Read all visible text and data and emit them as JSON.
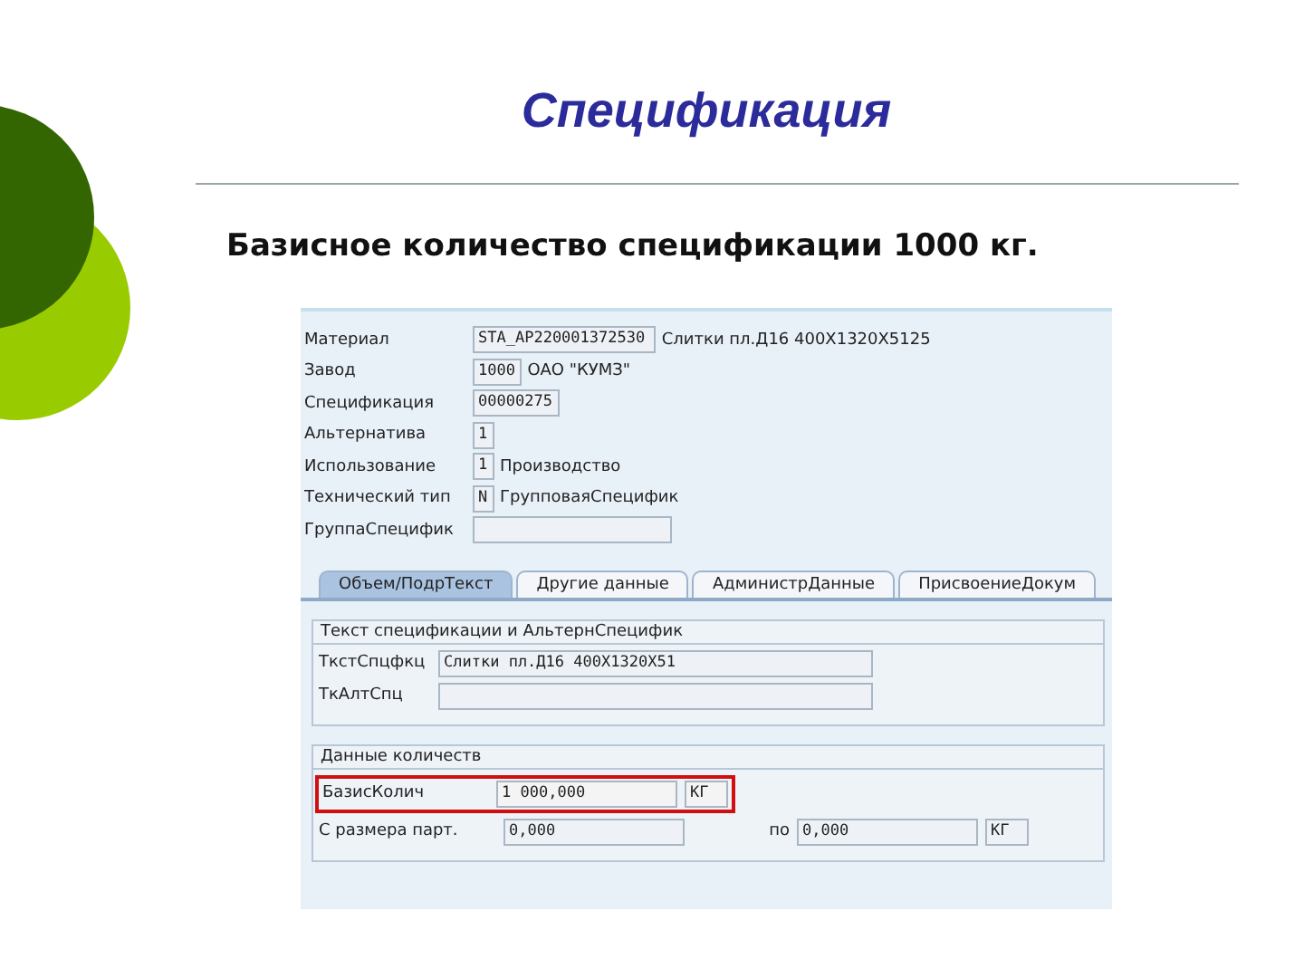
{
  "slide": {
    "title": "Спецификация",
    "subtitle": "Базисное количество спецификации 1000 кг."
  },
  "header_fields": [
    {
      "label": "Материал",
      "value": "STA_AP220001372530",
      "description": "Слитки пл.Д16 400X1320X5125"
    },
    {
      "label": "Завод",
      "value": "1000",
      "description": "ОАО \"КУМЗ\""
    },
    {
      "label": "Спецификация",
      "value": "00000275"
    },
    {
      "label": "Альтернатива",
      "value": "1"
    },
    {
      "label": "Использование",
      "value": "1",
      "description": "Производство"
    },
    {
      "label": "Технический тип",
      "value": "N",
      "description": "ГрупповаяСпецифик"
    },
    {
      "label": "ГруппаСпецифик"
    }
  ],
  "tabs": [
    {
      "label": "Объем/ПодрТекст",
      "selected": true
    },
    {
      "label": "Другие данные",
      "selected": false
    },
    {
      "label": "АдминистрДанные",
      "selected": false
    },
    {
      "label": "ПрисвоениеДокум",
      "selected": false
    }
  ],
  "text_section": {
    "title": "Текст спецификации и АльтернСпецифик",
    "rows": [
      {
        "label": "ТкстСпцфкц",
        "value": "Слитки пл.Д16 400X1320X51"
      },
      {
        "label": "ТкАлтСпц"
      }
    ]
  },
  "quantity_section": {
    "title": "Данные количеств",
    "base_quantity": {
      "label": "БазисКолич",
      "value": "1 000,000",
      "unit": "КГ",
      "highlighted": true
    },
    "lot_size": {
      "label": "С размера парт.",
      "from": "0,000",
      "to_label": "по",
      "to": "0,000",
      "unit": "КГ"
    }
  }
}
